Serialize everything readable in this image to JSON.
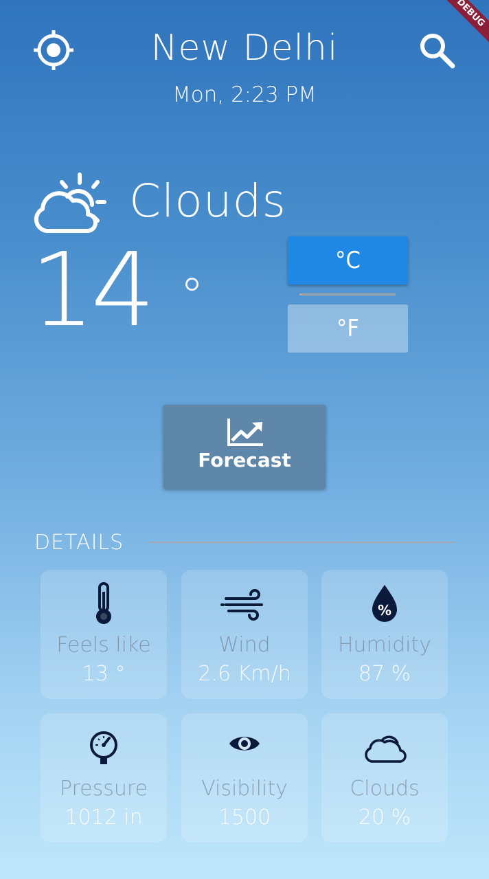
{
  "app": {
    "debug_banner": "DEBUG"
  },
  "header": {
    "city": "New Delhi",
    "datetime": "Mon, 2:23 PM",
    "location_icon": "gps-target-icon",
    "search_icon": "search-icon"
  },
  "current": {
    "condition": "Clouds",
    "condition_icon": "partly-cloudy-day-icon",
    "temperature": "14",
    "degree_symbol": "°"
  },
  "units": {
    "celsius_label": "°C",
    "fahrenheit_label": "°F",
    "selected": "celsius",
    "selected_color": "#1f88e5"
  },
  "forecast": {
    "label": "Forecast",
    "icon": "trending-up-chart-icon"
  },
  "details": {
    "title": "DETAILS",
    "items": [
      {
        "label": "Feels like",
        "value": "13 °",
        "icon": "thermometer-icon"
      },
      {
        "label": "Wind",
        "value": "2.6 Km/h",
        "icon": "wind-icon"
      },
      {
        "label": "Humidity",
        "value": "87 %",
        "icon": "humidity-drop-icon"
      },
      {
        "label": "Pressure",
        "value": "1012 in",
        "icon": "pressure-gauge-icon"
      },
      {
        "label": "Visibility",
        "value": "1500",
        "icon": "eye-icon"
      },
      {
        "label": "Clouds",
        "value": "20 %",
        "icon": "cloud-icon"
      }
    ]
  },
  "colors": {
    "gradient_top": "#2f74bd",
    "gradient_bottom": "#bfe6fb",
    "icon_dark": "#0b1a3a",
    "forecast_button": "#5f87aa"
  }
}
